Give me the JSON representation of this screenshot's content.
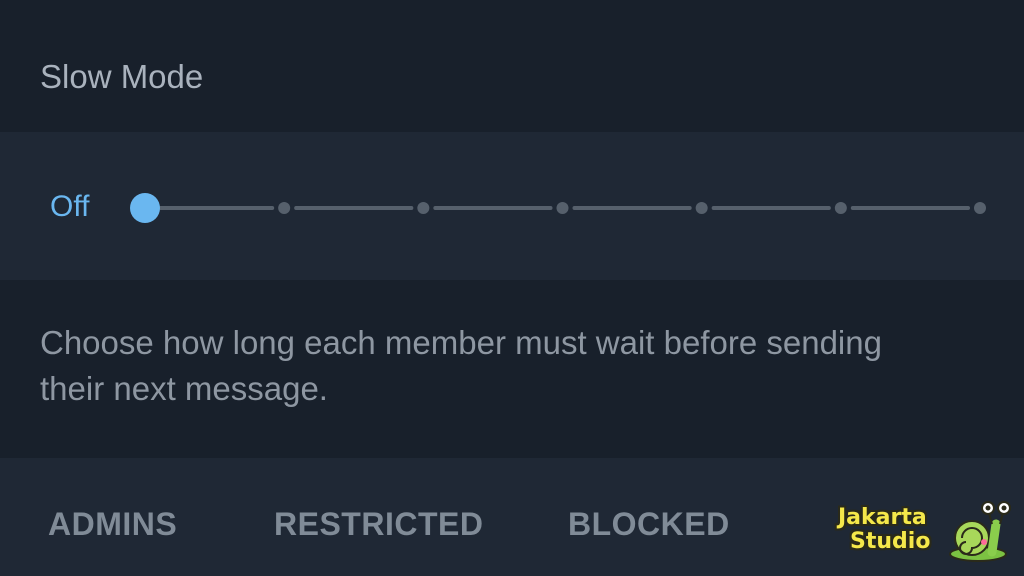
{
  "section": {
    "title": "Slow Mode"
  },
  "slider": {
    "value_label": "Off",
    "stops": 7,
    "selected_index": 0,
    "accent_color": "#6ab7f0",
    "track_color": "#56606c"
  },
  "info": {
    "text": "Choose how long each member must wait before sending their next message."
  },
  "tabs": [
    {
      "label": "ADMINS",
      "active": true
    },
    {
      "label": "RESTRICTED",
      "active": false
    },
    {
      "label": "BLOCKED",
      "active": false
    }
  ],
  "watermark": {
    "line1": "Jakarta",
    "line2": "Studio",
    "icon": "snail-mascot-icon"
  }
}
